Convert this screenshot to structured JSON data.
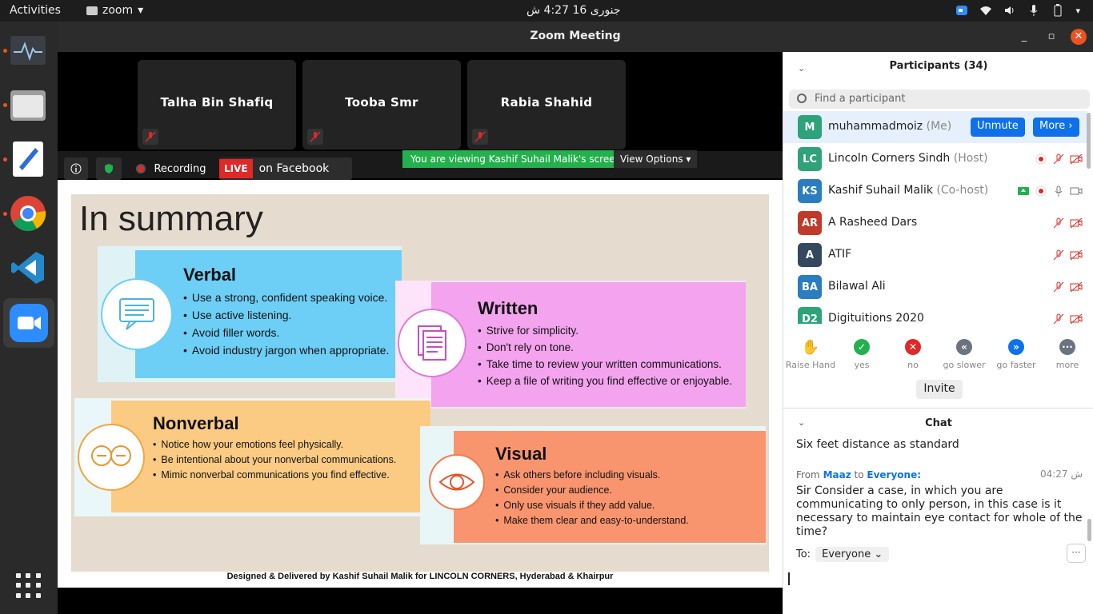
{
  "topbar": {
    "activities": "Activities",
    "app_name": "zoom",
    "clock": "جنوری 16  4:27 ش"
  },
  "window": {
    "title": "Zoom Meeting"
  },
  "tiles": [
    {
      "name": "Talha Bin Shafiq"
    },
    {
      "name": "Tooba Smr"
    },
    {
      "name": "Rabia Shahid"
    }
  ],
  "share": {
    "recording": "Recording",
    "live": "LIVE",
    "live_target": "on Facebook",
    "viewing": "You are viewing Kashif Suhail Malik's screen",
    "view_options": "View Options"
  },
  "slide": {
    "title": "In summary",
    "cards": [
      {
        "title": "Verbal",
        "items": [
          "Use a strong, confident speaking voice.",
          "Use active listening.",
          "Avoid filler words.",
          "Avoid industry jargon when appropriate."
        ],
        "color": "#6dcff6"
      },
      {
        "title": "Written",
        "items": [
          "Strive for simplicity.",
          "Don't rely on tone.",
          "Take time to review your written communications.",
          "Keep a file of writing you find effective or enjoyable."
        ],
        "color": "#f4a3ee"
      },
      {
        "title": "Nonverbal",
        "items": [
          "Notice how your emotions feel physically.",
          "Be intentional about your nonverbal communications.",
          "Mimic nonverbal communications you find effective."
        ],
        "color": "#fbcb83"
      },
      {
        "title": "Visual",
        "items": [
          "Ask others before including visuals.",
          "Consider your audience.",
          "Only use visuals if they add value.",
          "Make them clear and easy-to-understand."
        ],
        "color": "#f9956e"
      }
    ],
    "credit": "Designed & Delivered by Kashif Suhail Malik for LINCOLN CORNERS, Hyderabad & Khairpur"
  },
  "participants": {
    "header": "Participants (34)",
    "search_placeholder": "Find a participant",
    "unmute": "Unmute",
    "more": "More",
    "list": [
      {
        "initials": "M",
        "name": "muhammadmoiz",
        "role": "(Me)",
        "color": "#2ea37a"
      },
      {
        "initials": "LC",
        "name": "Lincoln Corners Sindh",
        "role": "(Host)",
        "color": "#2ea37a"
      },
      {
        "initials": "KS",
        "name": "Kashif Suhail Malik",
        "role": "(Co-host)",
        "color": "#2a7ebf"
      },
      {
        "initials": "AR",
        "name": "A Rasheed Dars",
        "role": "",
        "color": "#c0392b"
      },
      {
        "initials": "A",
        "name": "ATIF",
        "role": "",
        "color": "#34495e"
      },
      {
        "initials": "BA",
        "name": "Bilawal Ali",
        "role": "",
        "color": "#2a7ebf"
      },
      {
        "initials": "D2",
        "name": "Digituitions 2020",
        "role": "",
        "color": "#2ea37a"
      }
    ],
    "reactions": [
      {
        "label": "Raise Hand",
        "icon": "hand-icon",
        "color": "#0e71eb"
      },
      {
        "label": "yes",
        "icon": "check-icon",
        "color": "#22b14c"
      },
      {
        "label": "no",
        "icon": "x-icon",
        "color": "#e02828"
      },
      {
        "label": "go slower",
        "icon": "rewind-icon",
        "color": "#6b7380"
      },
      {
        "label": "go faster",
        "icon": "forward-icon",
        "color": "#0e71eb"
      },
      {
        "label": "more",
        "icon": "dots-icon",
        "color": "#6b7380"
      }
    ],
    "invite": "Invite"
  },
  "chat": {
    "header": "Chat",
    "prev_msg": "Six feet distance as standard",
    "from_label": "From",
    "sender": "Maaz",
    "to_label": "to",
    "recipient": "Everyone:",
    "time": "04:27 ش",
    "message": "Sir Consider a case, in which you are communicating to only person, in this case is it necessary to maintain eye contact for whole of the time?",
    "to_prefix": "To:",
    "to_value": "Everyone",
    "more_btn": "···"
  }
}
